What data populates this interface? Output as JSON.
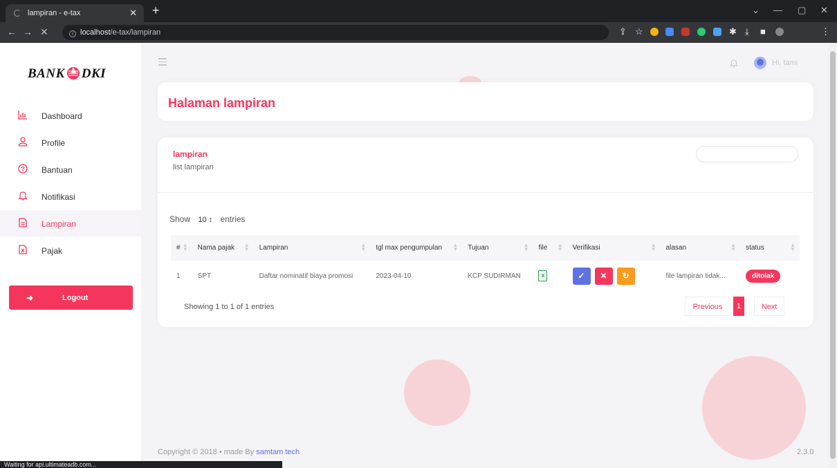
{
  "browser": {
    "tab_title": "lampiran - e-tax",
    "url_host": "localhost",
    "url_path": "/e-tax/lampiran",
    "status_text": "Waiting for api.ultimateadb.com..."
  },
  "sidebar": {
    "logo_left": "BANK",
    "logo_right": "DKI",
    "items": [
      {
        "label": "Dashboard",
        "icon": "chart-icon"
      },
      {
        "label": "Profile",
        "icon": "user-icon"
      },
      {
        "label": "Bantuan",
        "icon": "help-icon"
      },
      {
        "label": "Notifikasi",
        "icon": "bell-icon"
      },
      {
        "label": "Lampiran",
        "icon": "document-icon",
        "active": true
      },
      {
        "label": "Pajak",
        "icon": "excel-file-icon"
      }
    ],
    "logout_label": "Logout"
  },
  "header": {
    "user_greeting": "Hi, tami"
  },
  "page": {
    "title": "Halaman lampiran"
  },
  "card": {
    "title": "lampiran",
    "subtitle": "list lampiran",
    "show_label": "Show",
    "entries_value": "10 ↕",
    "entries_label": "entries",
    "columns": [
      "#",
      "Nama pajak",
      "Lampiran",
      "tgl max pengumpulan",
      "Tujuan",
      "file",
      "Verifikasi",
      "alasan",
      "status"
    ],
    "rows": [
      {
        "no": "1",
        "nama_pajak": "SPT",
        "lampiran": "Daftar nominatif biaya promosi",
        "tgl": "2023-04-10",
        "tujuan": "KCP SUDIRMAN",
        "alasan": "file lampiran tidak...",
        "status": "ditolak"
      }
    ],
    "info": "Showing 1 to 1 of 1 entries",
    "pagination": {
      "previous": "Previous",
      "current": "1",
      "next": "Next"
    }
  },
  "footer": {
    "copyright": "Copyright © 2018 • made By ",
    "author": "samtam tech",
    "version": "2.3.0"
  },
  "colors": {
    "accent": "#f5365c",
    "approve": "#5e72e4",
    "refresh": "#fb9b1b",
    "excel": "#20a148"
  }
}
